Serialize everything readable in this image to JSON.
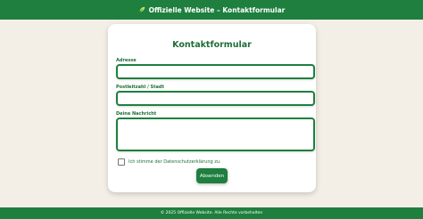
{
  "header": {
    "title": "Offizielle Website – Kontaktformular",
    "logo_icon": "leaf-icon"
  },
  "form": {
    "title": "Kontaktformular",
    "fields": [
      {
        "label": "Adresse",
        "value": "",
        "placeholder": ""
      },
      {
        "label": "Postleitzahl / Stadt",
        "value": "",
        "placeholder": ""
      },
      {
        "label": "Deine Nachricht",
        "value": "",
        "placeholder": ""
      }
    ],
    "consent_label": "Ich stimme der Datenschutzerklärung zu.",
    "consent_checked": false,
    "submit_label": "Absenden"
  },
  "footer": {
    "text": "© 2025 Offizielle Website. Alle Rechte vorbehalten"
  },
  "colors": {
    "brand": "#1e7f3e",
    "background": "#f3efe7",
    "text": "#1e6e37"
  }
}
